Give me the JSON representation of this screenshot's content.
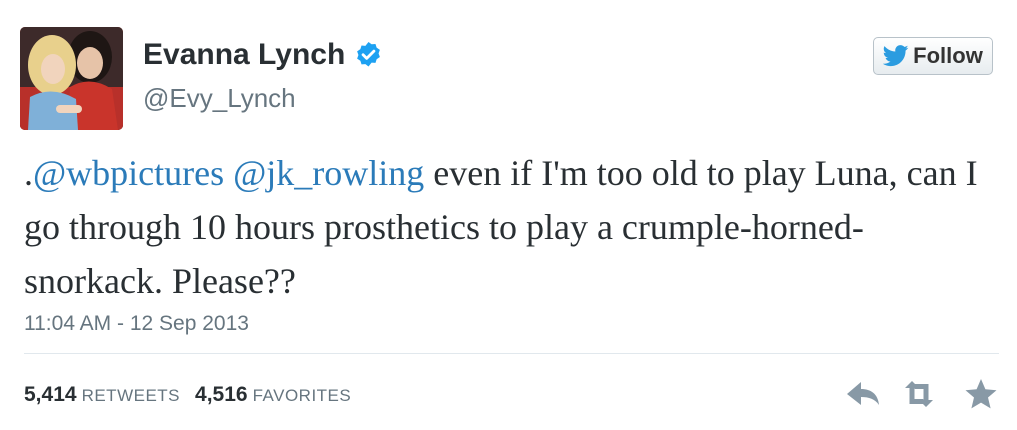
{
  "user": {
    "display_name": "Evanna Lynch",
    "handle": "@Evy_Lynch",
    "verified": true
  },
  "follow": {
    "label": "Follow"
  },
  "tweet": {
    "prefix": ".",
    "mention_1": "@wbpictures",
    "separator": " ",
    "mention_2": "@jk_rowling",
    "body": " even if I'm too old to play Luna, can I go through 10 hours prosthetics to play a crumple-horned-snorkack. Please??"
  },
  "timestamp": "11:04 AM - 12 Sep 2013",
  "stats": {
    "retweets_count": "5,414",
    "retweets_label": "RETWEETS",
    "favorites_count": "4,516",
    "favorites_label": "FAVORITES"
  },
  "colors": {
    "link": "#2b7bb9",
    "verified": "#1da1f2",
    "muted": "#66757f",
    "action_icon": "#8899a6"
  },
  "icons": {
    "verified": "verified-badge-icon",
    "follow": "twitter-bird-icon",
    "reply": "reply-arrow-icon",
    "retweet": "retweet-icon",
    "favorite": "star-icon"
  }
}
